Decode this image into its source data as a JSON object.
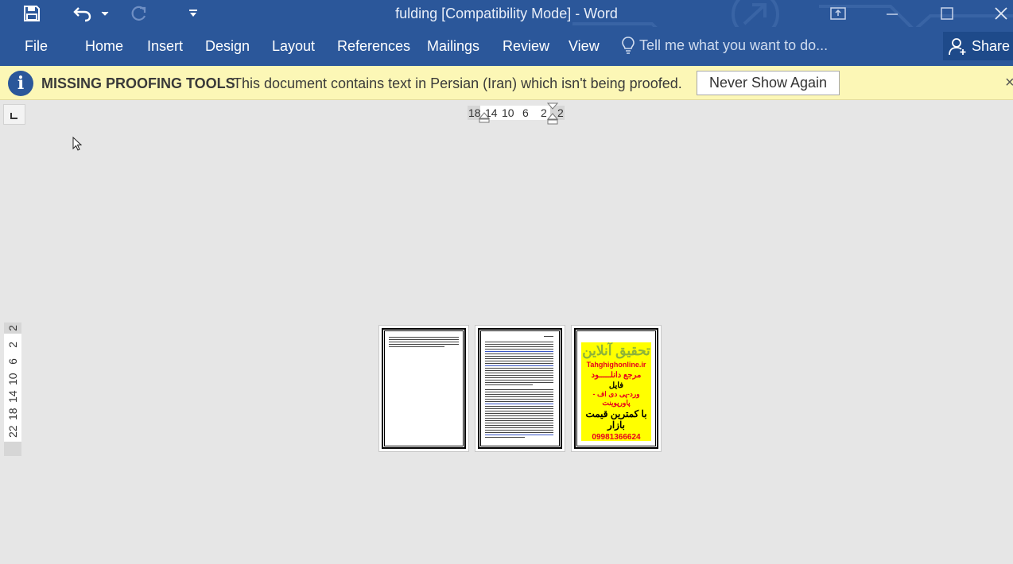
{
  "window": {
    "title": "fulding [Compatibility Mode] - Word"
  },
  "ribbon": {
    "tabs": [
      "File",
      "Home",
      "Insert",
      "Design",
      "Layout",
      "References",
      "Mailings",
      "Review",
      "View"
    ],
    "tell_me_placeholder": "Tell me what you want to do...",
    "share_label": "Share"
  },
  "message_bar": {
    "label": "MISSING PROOFING TOOLS",
    "message": "This document contains text in Persian (Iran) which isn't being proofed.",
    "button_label": "Never Show Again",
    "close_glyph": "×"
  },
  "horizontal_ruler": {
    "ticks": [
      "18",
      "14",
      "10",
      "6",
      "2",
      "2"
    ]
  },
  "vertical_ruler": {
    "ticks": [
      "2",
      "2",
      "6",
      "10",
      "14",
      "18",
      "22"
    ]
  },
  "pages": {
    "ad": {
      "title": "تحقیق آنلاین",
      "site": "Tahghighonline.ir",
      "line1": "مرجع دانلـــــود",
      "line2": "فایل",
      "line3": "ورد-پی دی اف - پاورپوینت",
      "line4": "با کمترین قیمت بازار",
      "phone": "09981366624 واتساپ"
    }
  },
  "colors": {
    "brand": "#2b579a",
    "message_bar": "#fcf7b6",
    "canvas": "#e6e6e6",
    "ad_background": "#ffff00",
    "ad_red": "#e8001c",
    "ad_green": "#8db33a"
  },
  "icons": {
    "save": "save-icon",
    "undo": "undo-icon",
    "redo": "redo-icon",
    "customize": "customize-qat-icon",
    "ribbon_display": "ribbon-display-options-icon",
    "minimize": "minimize-icon",
    "maximize": "maximize-icon",
    "close": "close-icon",
    "lightbulb": "lightbulb-icon",
    "person": "person-icon",
    "info": "info-icon"
  }
}
